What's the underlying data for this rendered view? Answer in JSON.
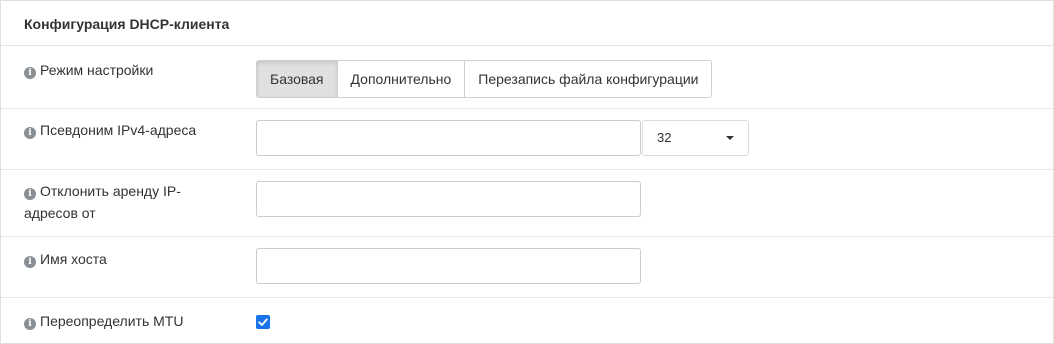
{
  "section": {
    "title": "Конфигурация DHCP-клиента"
  },
  "rows": {
    "mode": {
      "label": "Режим настройки",
      "options": [
        "Базовая",
        "Дополнительно",
        "Перезапись файла конфигурации"
      ],
      "selected": "Базовая"
    },
    "alias": {
      "label": "Псевдоним IPv4-адреса",
      "value": "",
      "prefix": "32"
    },
    "reject": {
      "label": "Отклонить аренду IP-адресов от",
      "value": ""
    },
    "hostname": {
      "label": "Имя хоста",
      "value": ""
    },
    "mtu": {
      "label": "Переопределить MTU",
      "checked": true
    }
  },
  "icons": {
    "info": "info-circle-icon",
    "caret": "caret-down-icon",
    "check": "check-icon"
  },
  "colors": {
    "checkbox": "#1a73e8",
    "active_button": "#e0e0e0"
  }
}
